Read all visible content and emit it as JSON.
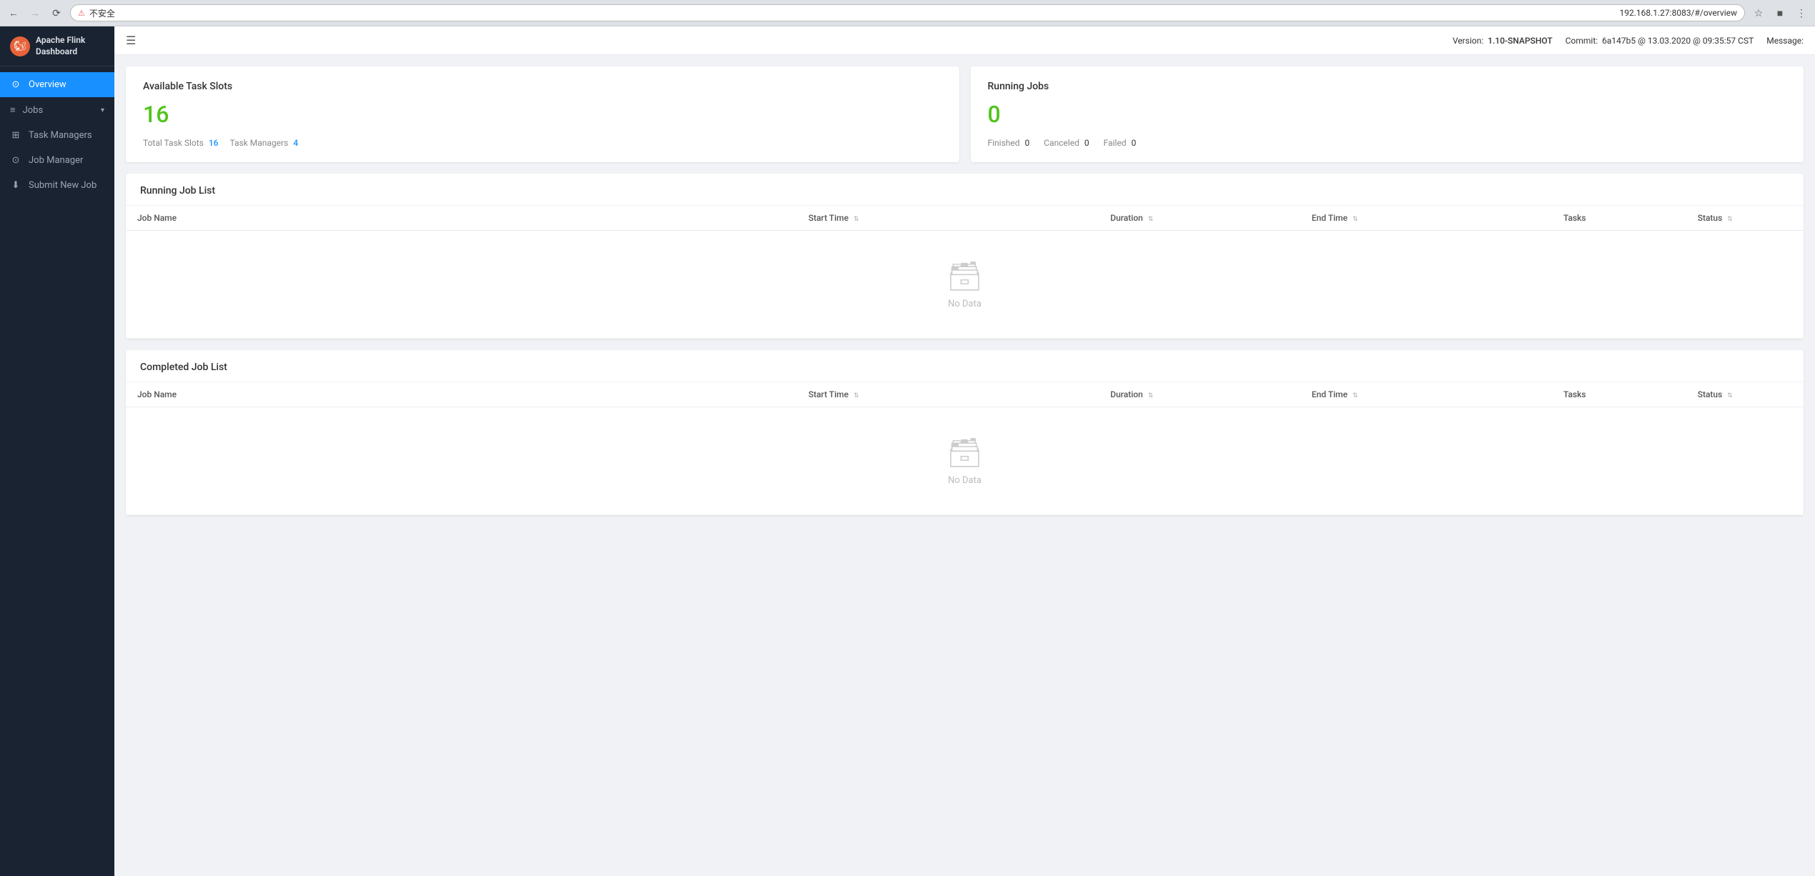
{
  "browser": {
    "url": "192.168.1.27:8083/#/overview",
    "url_security_label": "不安全",
    "back_disabled": false,
    "forward_disabled": true
  },
  "topbar": {
    "menu_icon": "☰",
    "version_label": "Version:",
    "version_value": "1.10-SNAPSHOT",
    "commit_label": "Commit:",
    "commit_value": "6a147b5 @ 13.03.2020 @ 09:35:57 CST",
    "message_label": "Message:"
  },
  "sidebar": {
    "logo_text": "Apache Flink Dashboard",
    "items": [
      {
        "id": "overview",
        "label": "Overview",
        "icon": "⊙",
        "active": true
      },
      {
        "id": "jobs",
        "label": "Jobs",
        "icon": "≡",
        "has_dropdown": true
      },
      {
        "id": "task-managers",
        "label": "Task Managers",
        "icon": "⊞"
      },
      {
        "id": "job-manager",
        "label": "Job Manager",
        "icon": "⊙"
      },
      {
        "id": "submit-new-job",
        "label": "Submit New Job",
        "icon": "⬇"
      }
    ]
  },
  "available_task_slots": {
    "title": "Available Task Slots",
    "value": "16",
    "total_task_slots_label": "Total Task Slots",
    "total_task_slots_value": "16",
    "task_managers_label": "Task Managers",
    "task_managers_value": "4"
  },
  "running_jobs": {
    "title": "Running Jobs",
    "value": "0",
    "finished_label": "Finished",
    "finished_value": "0",
    "canceled_label": "Canceled",
    "canceled_value": "0",
    "failed_label": "Failed",
    "failed_value": "0"
  },
  "running_job_list": {
    "title": "Running Job List",
    "columns": [
      {
        "id": "job-name",
        "label": "Job Name",
        "sortable": false
      },
      {
        "id": "start-time",
        "label": "Start Time",
        "sortable": true
      },
      {
        "id": "duration",
        "label": "Duration",
        "sortable": true
      },
      {
        "id": "end-time",
        "label": "End Time",
        "sortable": true
      },
      {
        "id": "tasks",
        "label": "Tasks",
        "sortable": false
      },
      {
        "id": "status",
        "label": "Status",
        "sortable": true
      }
    ],
    "no_data_text": "No Data",
    "rows": []
  },
  "completed_job_list": {
    "title": "Completed Job List",
    "columns": [
      {
        "id": "job-name",
        "label": "Job Name",
        "sortable": false
      },
      {
        "id": "start-time",
        "label": "Start Time",
        "sortable": true
      },
      {
        "id": "duration",
        "label": "Duration",
        "sortable": true
      },
      {
        "id": "end-time",
        "label": "End Time",
        "sortable": true
      },
      {
        "id": "tasks",
        "label": "Tasks",
        "sortable": false
      },
      {
        "id": "status",
        "label": "Status",
        "sortable": true
      }
    ],
    "no_data_text": "No Data",
    "rows": []
  }
}
